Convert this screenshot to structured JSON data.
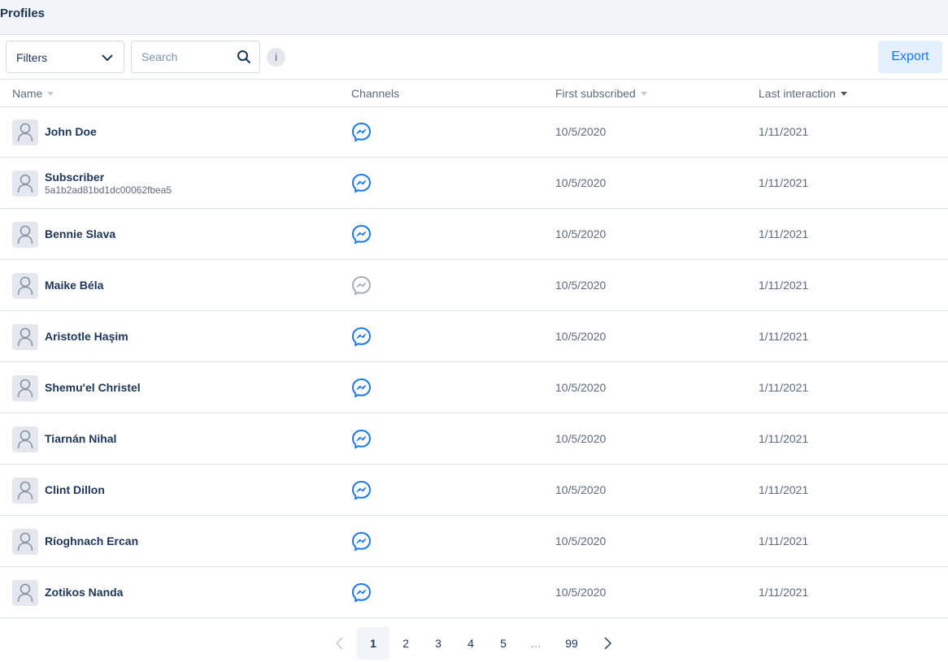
{
  "header": {
    "title": "Profiles"
  },
  "toolbar": {
    "filters_label": "Filters",
    "search_placeholder": "Search",
    "info_label": "i",
    "export_label": "Export"
  },
  "columns": {
    "name": "Name",
    "channels": "Channels",
    "first_subscribed": "First subscribed",
    "last_interaction": "Last interaction"
  },
  "rows": [
    {
      "name": "John Doe",
      "subid": "",
      "channel": "messenger-icon",
      "channel_active": true,
      "first": "10/5/2020",
      "last": "1/11/2021"
    },
    {
      "name": "Subscriber",
      "subid": "5a1b2ad81bd1dc00062fbea5",
      "channel": "messenger-icon",
      "channel_active": true,
      "first": "10/5/2020",
      "last": "1/11/2021"
    },
    {
      "name": "Bennie Slava",
      "subid": "",
      "channel": "messenger-icon",
      "channel_active": true,
      "first": "10/5/2020",
      "last": "1/11/2021"
    },
    {
      "name": "Maike Béla",
      "subid": "",
      "channel": "messenger-icon",
      "channel_active": false,
      "first": "10/5/2020",
      "last": "1/11/2021"
    },
    {
      "name": "Aristotle Haşim",
      "subid": "",
      "channel": "messenger-icon",
      "channel_active": true,
      "first": "10/5/2020",
      "last": "1/11/2021"
    },
    {
      "name": "Shemu'el Christel",
      "subid": "",
      "channel": "messenger-icon",
      "channel_active": true,
      "first": "10/5/2020",
      "last": "1/11/2021"
    },
    {
      "name": "Tiarnán Nihal",
      "subid": "",
      "channel": "messenger-icon",
      "channel_active": true,
      "first": "10/5/2020",
      "last": "1/11/2021"
    },
    {
      "name": "Clint Dillon",
      "subid": "",
      "channel": "messenger-icon",
      "channel_active": true,
      "first": "10/5/2020",
      "last": "1/11/2021"
    },
    {
      "name": "Ríoghnach Ercan",
      "subid": "",
      "channel": "messenger-icon",
      "channel_active": true,
      "first": "10/5/2020",
      "last": "1/11/2021"
    },
    {
      "name": "Zotikos Nanda",
      "subid": "",
      "channel": "messenger-icon",
      "channel_active": true,
      "first": "10/5/2020",
      "last": "1/11/2021"
    }
  ],
  "pagination": {
    "pages": [
      "1",
      "2",
      "3",
      "4",
      "5",
      "…",
      "99"
    ],
    "current": "1"
  },
  "colors": {
    "accent": "#1877f2",
    "inactive_icon": "#a3adb9",
    "text_primary": "#1d3557",
    "text_secondary": "#5d6b7e"
  }
}
